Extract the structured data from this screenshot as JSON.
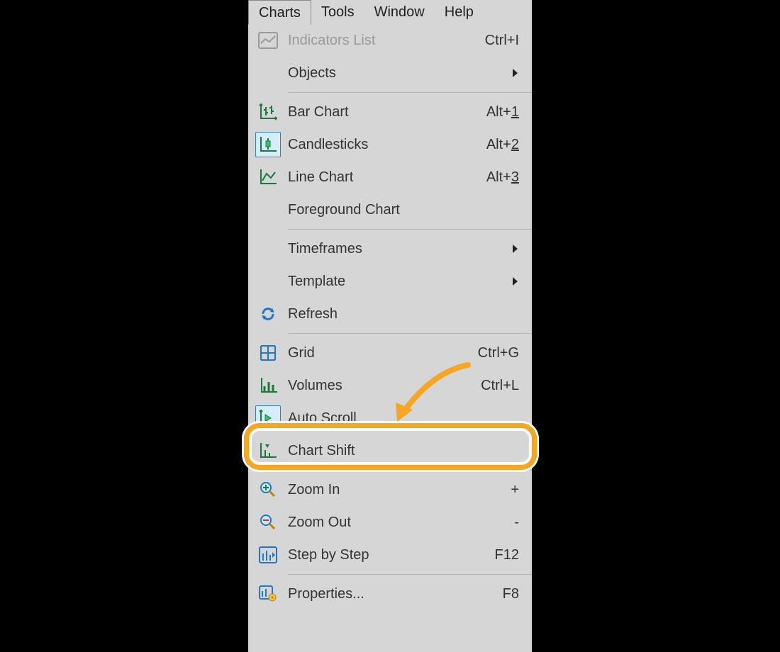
{
  "menubar": {
    "items": [
      {
        "label": "Charts",
        "active": true
      },
      {
        "label": "Tools"
      },
      {
        "label": "Window"
      },
      {
        "label": "Help"
      }
    ]
  },
  "menu": {
    "indicators": {
      "label": "Indicators List",
      "shortcut": "Ctrl+I"
    },
    "objects": {
      "label": "Objects"
    },
    "bar_chart": {
      "label": "Bar Chart",
      "shortcut_prefix": "Alt+",
      "shortcut_key": "1"
    },
    "candlesticks": {
      "label": "Candlesticks",
      "shortcut_prefix": "Alt+",
      "shortcut_key": "2"
    },
    "line_chart": {
      "label": "Line Chart",
      "shortcut_prefix": "Alt+",
      "shortcut_key": "3"
    },
    "foreground": {
      "label": "Foreground Chart"
    },
    "timeframes": {
      "label": "Timeframes"
    },
    "template": {
      "label": "Template"
    },
    "refresh": {
      "label": "Refresh"
    },
    "grid": {
      "label": "Grid",
      "shortcut": "Ctrl+G"
    },
    "volumes": {
      "label": "Volumes",
      "shortcut": "Ctrl+L"
    },
    "auto_scroll": {
      "label": "Auto Scroll"
    },
    "chart_shift": {
      "label": "Chart Shift"
    },
    "zoom_in": {
      "label": "Zoom In",
      "shortcut": "+"
    },
    "zoom_out": {
      "label": "Zoom Out",
      "shortcut": "-"
    },
    "step": {
      "label": "Step by Step",
      "shortcut": "F12"
    },
    "properties": {
      "label": "Properties...",
      "shortcut": "F8"
    }
  }
}
